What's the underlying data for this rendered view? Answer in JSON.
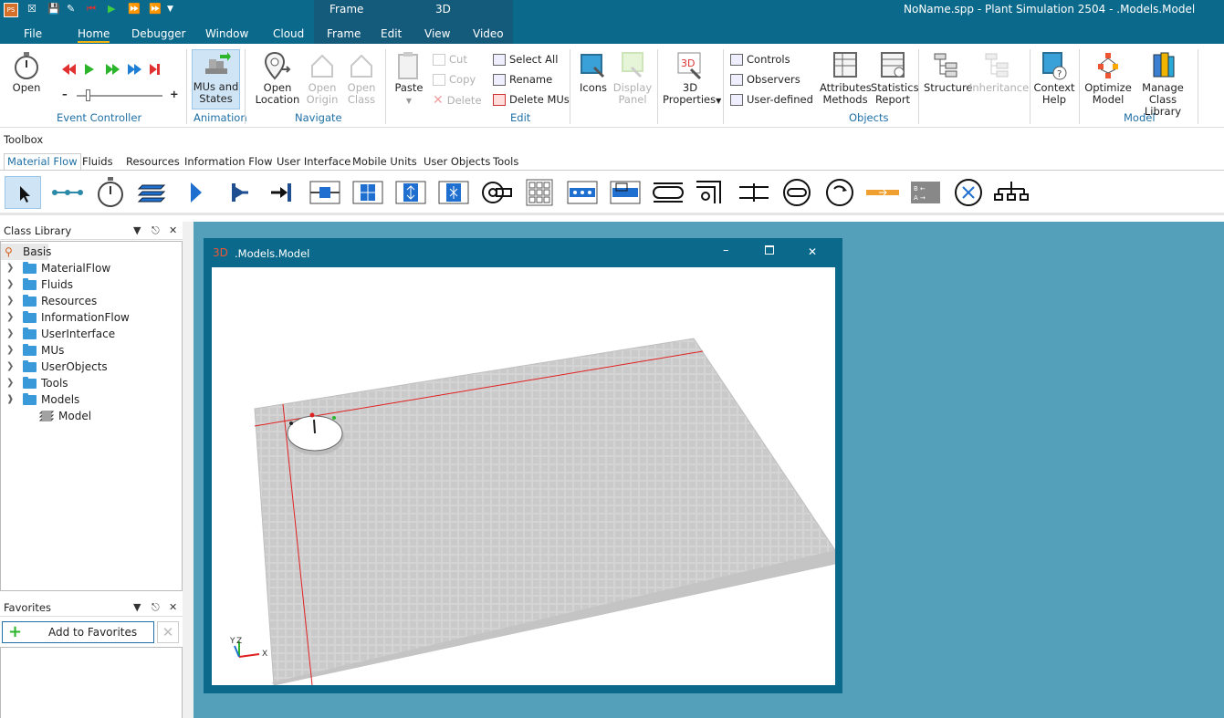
{
  "titlebar": {
    "window_title": "NoName.spp - Plant Simulation 2504 - .Models.Model",
    "context_frame": "Frame",
    "context_3d": "3D",
    "menu_tabs": [
      "File",
      "Home",
      "Debugger",
      "Window",
      "Cloud",
      "Frame",
      "Edit",
      "View",
      "Video"
    ]
  },
  "ribbon": {
    "event_controller": {
      "open": "Open",
      "minus": "–",
      "plus": "+",
      "group": "Event Controller"
    },
    "animation": {
      "mus_states": "MUs and States",
      "group": "Animation"
    },
    "navigate": {
      "open_location": "Open Location",
      "open_origin": "Open Origin",
      "open_class": "Open Class",
      "group": "Navigate"
    },
    "edit": {
      "paste": "Paste",
      "cut": "Cut",
      "copy": "Copy",
      "delete": "Delete",
      "select_all": "Select All",
      "rename": "Rename",
      "delete_mus": "Delete MUs",
      "group": "Edit"
    },
    "icons": {
      "icons": "Icons",
      "display_panel": "Display Panel"
    },
    "properties": {
      "props_3d": "3D Properties",
      "icon_text": "3D"
    },
    "objects": {
      "controls": "Controls",
      "observers": "Observers",
      "user_defined": "User-defined",
      "attributes_methods": "Attributes Methods",
      "statistics_report": "Statistics Report",
      "group": "Objects"
    },
    "structure": {
      "structure": "Structure",
      "inheritance": "Inheritance"
    },
    "help": {
      "context_help": "Context Help"
    },
    "model": {
      "optimize": "Optimize Model",
      "manage_library": "Manage Class Library",
      "group": "Model"
    }
  },
  "toolbox": {
    "label": "Toolbox",
    "tabs": [
      "Material Flow",
      "Fluids",
      "Resources",
      "Information Flow",
      "User Interface",
      "Mobile Units",
      "User Objects",
      "Tools"
    ]
  },
  "class_library": {
    "title": "Class Library",
    "root": "Basis",
    "items": [
      "MaterialFlow",
      "Fluids",
      "Resources",
      "InformationFlow",
      "UserInterface",
      "MUs",
      "UserObjects",
      "Tools",
      "Models"
    ],
    "child": "Model"
  },
  "favorites": {
    "title": "Favorites",
    "add_button": "Add to Favorites"
  },
  "model_window": {
    "icon_text": "3D",
    "title": ".Models.Model",
    "axis_y": "Y",
    "axis_z": "Z",
    "axis_x": "X"
  },
  "colors": {
    "titlebar": "#0b6a8c",
    "mdi_background": "#54a0bb",
    "accent_tab": "#f2b40c",
    "group_label": "#1d6fa5"
  }
}
